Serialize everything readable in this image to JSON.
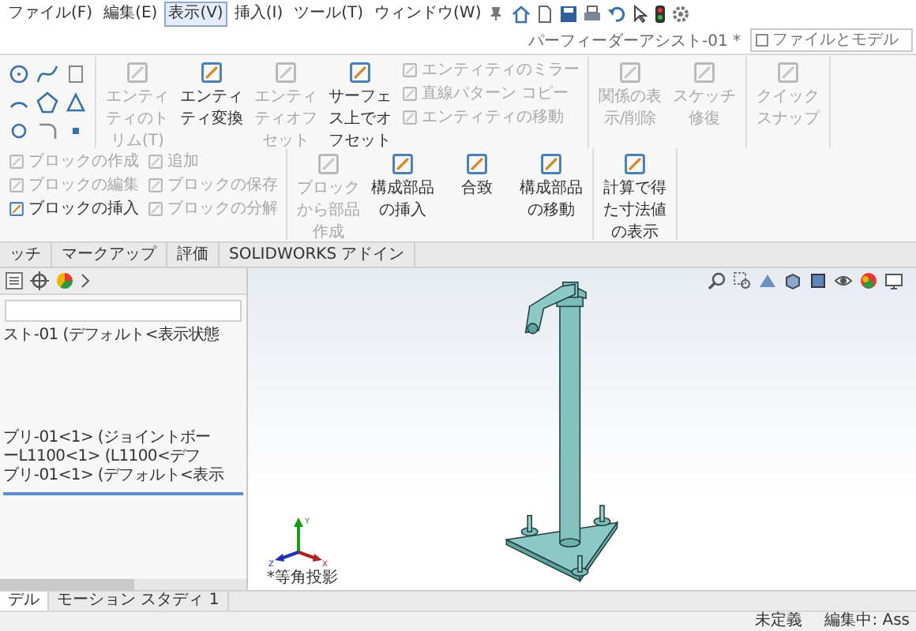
{
  "menu": [
    {
      "label": "ファイル(F)",
      "selected": false
    },
    {
      "label": "編集(E)",
      "selected": false
    },
    {
      "label": "表示(V)",
      "selected": true
    },
    {
      "label": "挿入(I)",
      "selected": false
    },
    {
      "label": "ツール(T)",
      "selected": false
    },
    {
      "label": "ウィンドウ(W)",
      "selected": false
    }
  ],
  "title": "パーフィーダーアシスト-01 *",
  "search": {
    "placeholder": "ファイルとモデル"
  },
  "ribbon": {
    "groups": [
      {
        "items": [
          {
            "kind": "large",
            "label": "エンティティのトリム(T)",
            "disabled": true
          },
          {
            "kind": "large",
            "label": "エンティティ変換",
            "disabled": false
          },
          {
            "kind": "large",
            "label": "エンティティオフセット",
            "disabled": true
          },
          {
            "kind": "large",
            "label": "サーフェス上でオフセット",
            "disabled": false
          },
          {
            "kind": "small",
            "label": "エンティティのミラー",
            "disabled": true
          },
          {
            "kind": "small",
            "label": "直線パターン コピー",
            "disabled": true
          },
          {
            "kind": "small",
            "label": "エンティティの移動",
            "disabled": true
          }
        ]
      },
      {
        "items": [
          {
            "kind": "large",
            "label": "関係の表示/削除",
            "disabled": true
          },
          {
            "kind": "large",
            "label": "スケッチ修復",
            "disabled": true
          }
        ]
      },
      {
        "items": [
          {
            "kind": "large",
            "label": "クイックスナップ",
            "disabled": true
          }
        ]
      },
      {
        "items": [
          {
            "kind": "small",
            "label": "ブロックの作成",
            "disabled": true
          },
          {
            "kind": "small",
            "label": "ブロックの編集",
            "disabled": true
          },
          {
            "kind": "small",
            "label": "ブロックの挿入",
            "disabled": false
          },
          {
            "kind": "small",
            "label": "追加",
            "disabled": true
          },
          {
            "kind": "small",
            "label": "ブロックの保存",
            "disabled": true
          },
          {
            "kind": "small",
            "label": "ブロックの分解",
            "disabled": true
          }
        ]
      },
      {
        "items": [
          {
            "kind": "large",
            "label": "ブロックから部品作成",
            "disabled": true
          },
          {
            "kind": "large",
            "label": "構成部品の挿入",
            "disabled": false
          },
          {
            "kind": "large",
            "label": "合致",
            "disabled": false
          },
          {
            "kind": "large",
            "label": "構成部品の移動",
            "disabled": false
          }
        ]
      },
      {
        "items": [
          {
            "kind": "large",
            "label": "計算で得た寸法値の表示",
            "disabled": false
          }
        ]
      }
    ]
  },
  "tabs": [
    {
      "label": "ッチ",
      "selected": false
    },
    {
      "label": "マークアップ",
      "selected": false
    },
    {
      "label": "評価",
      "selected": false
    },
    {
      "label": "SOLIDWORKS アドイン",
      "selected": false
    }
  ],
  "tree": {
    "label": "スト-01 (デフォルト<表示状態",
    "children": [
      {
        "label": "ブリ-01<1> (ジョイントボー"
      },
      {
        "label": "ーL1100<1> (L1100<デフ"
      },
      {
        "label": "ブリ-01<1> (デフォルト<表示"
      }
    ]
  },
  "triad_labels": [
    "Y",
    "Z",
    "X"
  ],
  "view_label": "*等角投影",
  "bottom_tabs": [
    {
      "label": "デル",
      "selected": true
    },
    {
      "label": "モーション スタディ 1",
      "selected": false
    }
  ],
  "status_bar": [
    "未定義",
    "編集中: Ass"
  ]
}
